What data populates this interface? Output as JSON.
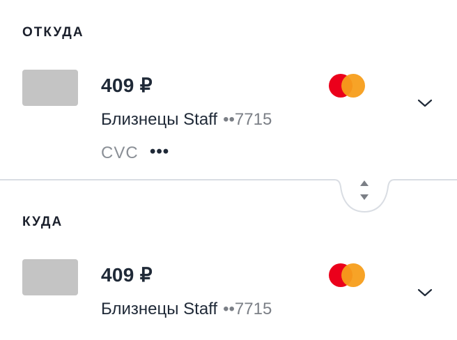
{
  "from": {
    "title": "ОТКУДА",
    "amount": "409 ₽",
    "card_name": "Близнецы Staff",
    "card_mask": "••7715",
    "cvc_label": "CVC",
    "cvc_value": "•••",
    "card_brand_icon": "mastercard-icon",
    "expand_icon": "chevron-down-icon"
  },
  "to": {
    "title": "КУДА",
    "amount": "409 ₽",
    "card_name": "Близнецы Staff",
    "card_mask": "••7715",
    "card_brand_icon": "mastercard-icon",
    "expand_icon": "chevron-down-icon"
  },
  "swap_icon": "swap-arrows-icon",
  "colors": {
    "text": "#1f2937",
    "muted": "#8a8f96",
    "divider": "#d9dde3",
    "mastercard_red": "#eb001b",
    "mastercard_orange": "#f79e1b",
    "thumb": "#c4c4c4"
  }
}
